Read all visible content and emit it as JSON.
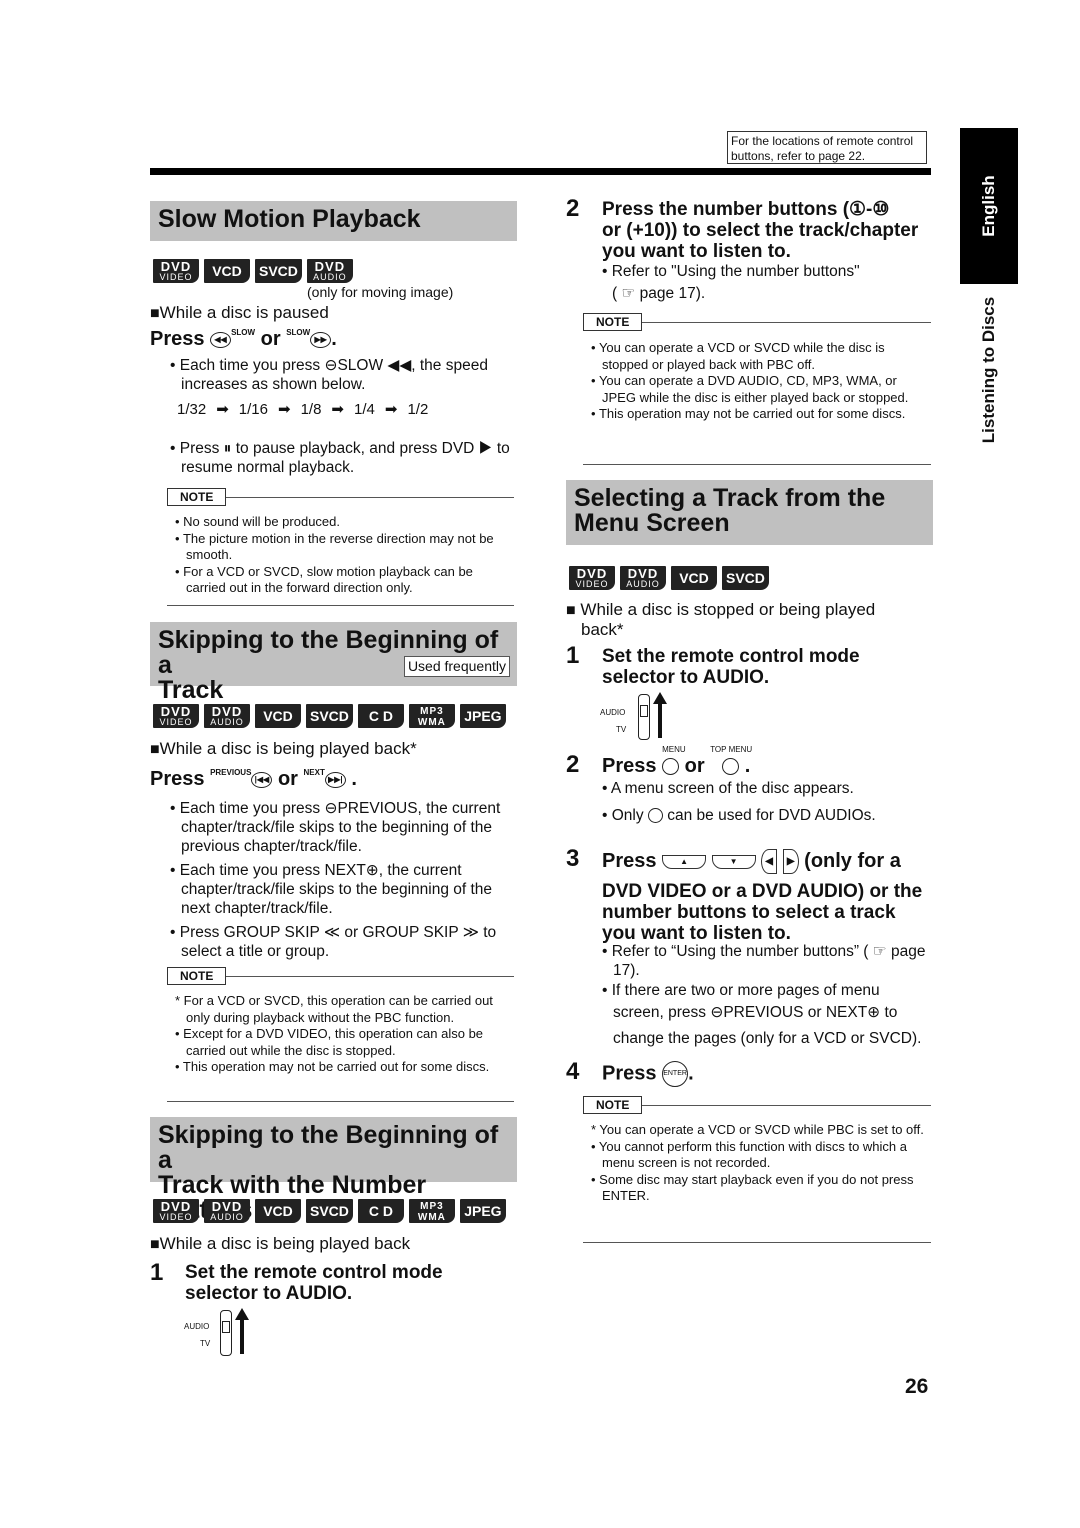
{
  "header": {
    "ref_note": "For the locations of remote control buttons, refer to page 22."
  },
  "side": {
    "language": "English",
    "section": "Listening to Discs"
  },
  "page_number": "26",
  "slow_motion": {
    "title": "Slow Motion Playback",
    "badges": [
      {
        "top": "DVD",
        "bottom": "VIDEO"
      },
      {
        "top": "VCD",
        "bottom": ""
      },
      {
        "top": "SVCD",
        "bottom": ""
      },
      {
        "top": "DVD",
        "bottom": "AUDIO"
      }
    ],
    "badge_note": "(only for moving image)",
    "condition": "While a disc is paused",
    "press_label": "Press",
    "or_label": "or",
    "btn_slow_minus": "SLOW",
    "btn_slow_plus": "SLOW",
    "bullet1": "Each time you press ⊖SLOW ◀◀, the speed increases as shown below.",
    "speeds": [
      "1/32",
      "1/16",
      "1/8",
      "1/4",
      "1/2"
    ],
    "bullet2": "Press ⏸ to pause playback, and press DVD ▶ to resume normal playback.",
    "note_label": "NOTE",
    "notes": [
      "No sound will be produced.",
      "The picture motion in the reverse direction may not be smooth.",
      "For a VCD or SVCD, slow motion playback can be carried out in the forward direction only."
    ]
  },
  "skip_track": {
    "title_line1": "Skipping to the Beginning of a",
    "title_line2": "Track",
    "tag": "Used frequently",
    "badges": [
      {
        "top": "DVD",
        "bottom": "VIDEO"
      },
      {
        "top": "DVD",
        "bottom": "AUDIO"
      },
      {
        "top": "VCD",
        "bottom": ""
      },
      {
        "top": "SVCD",
        "bottom": ""
      },
      {
        "top": "C D",
        "bottom": ""
      },
      {
        "top": "MP3",
        "bottom": "WMA"
      },
      {
        "top": "JPEG",
        "bottom": ""
      }
    ],
    "condition": "While a disc is being played back*",
    "press_label": "Press",
    "or_label": "or",
    "btn_prev": "PREVIOUS",
    "btn_next": "NEXT",
    "bullet1": "Each time you press ⊖PREVIOUS, the current chapter/track/file skips to the beginning of the previous chapter/track/file.",
    "bullet2": "Each time you press NEXT⊕, the current chapter/track/file skips to the beginning of the next chapter/track/file.",
    "bullet3": "Press GROUP SKIP ≪ or GROUP SKIP ≫ to select a title or group.",
    "note_label": "NOTE",
    "notes": [
      "* For a VCD or SVCD, this operation can be carried out only during playback without the PBC function.",
      "• Except for a DVD VIDEO, this operation can also be carried out while the disc is stopped.",
      "• This operation may not be carried out for some discs."
    ]
  },
  "skip_number": {
    "title_line1": "Skipping to the Beginning of a",
    "title_line2": "Track with the Number Buttons",
    "badges": [
      {
        "top": "DVD",
        "bottom": "VIDEO"
      },
      {
        "top": "DVD",
        "bottom": "AUDIO"
      },
      {
        "top": "VCD",
        "bottom": ""
      },
      {
        "top": "SVCD",
        "bottom": ""
      },
      {
        "top": "C D",
        "bottom": ""
      },
      {
        "top": "MP3",
        "bottom": "WMA"
      },
      {
        "top": "JPEG",
        "bottom": ""
      }
    ],
    "condition": "While a disc is being played back",
    "step1_num": "1",
    "step1": "Set the remote control mode selector to AUDIO.",
    "selector_audio": "AUDIO",
    "selector_tv": "TV",
    "step2_num": "2",
    "step2_line1": "Press the number buttons (①-⑩",
    "step2_line2": "or (+10)) to select the track/chapter",
    "step2_line3": "you want to listen to.",
    "step2_bullet": "Refer to \"Using the number buttons\"",
    "step2_ref": "( ☞ page 17).",
    "note_label": "NOTE",
    "notes": [
      "You can operate a VCD or SVCD while the disc is stopped or played back with PBC off.",
      "You can operate a DVD AUDIO, CD, MP3, WMA, or JPEG while the disc is either played back or stopped.",
      "This operation may not be carried out for some discs."
    ]
  },
  "menu_select": {
    "title_line1": "Selecting a Track from the",
    "title_line2": "Menu Screen",
    "badges": [
      {
        "top": "DVD",
        "bottom": "VIDEO"
      },
      {
        "top": "DVD",
        "bottom": "AUDIO"
      },
      {
        "top": "VCD",
        "bottom": ""
      },
      {
        "top": "SVCD",
        "bottom": ""
      }
    ],
    "condition_line1": "While a disc is stopped or being played",
    "condition_line2": "back*",
    "step1_num": "1",
    "step1": "Set the remote control mode selector to AUDIO.",
    "selector_audio": "AUDIO",
    "selector_tv": "TV",
    "step2_num": "2",
    "step2_press": "Press",
    "step2_or": "or",
    "btn_menu": "MENU",
    "btn_top_menu": "TOP MENU",
    "step2_bullet1": "A menu screen of the disc appears.",
    "step2_bullet2_a": "Only",
    "step2_bullet2_b": "can be used for DVD AUDIOs.",
    "step3_num": "3",
    "step3_press": "Press",
    "step3_tail": "(only for a",
    "step3_rest": "DVD VIDEO or a DVD AUDIO) or the number buttons to select a track you want to listen to.",
    "step3_bullet1": "Refer to “Using the number buttons” ( ☞ page 17).",
    "step3_bullet2_a": "If there are two or more pages of menu",
    "step3_bullet2_b": "screen, press ⊖PREVIOUS or NEXT⊕ to change the pages (only for a VCD or SVCD).",
    "step4_num": "4",
    "step4_press": "Press",
    "btn_enter": "ENTER",
    "note_label": "NOTE",
    "notes": [
      "* You can operate a VCD or SVCD while PBC is set to off.",
      "• You cannot perform this function with discs to which a menu screen is not recorded.",
      "• Some disc may start playback even if you do not press ENTER."
    ]
  }
}
